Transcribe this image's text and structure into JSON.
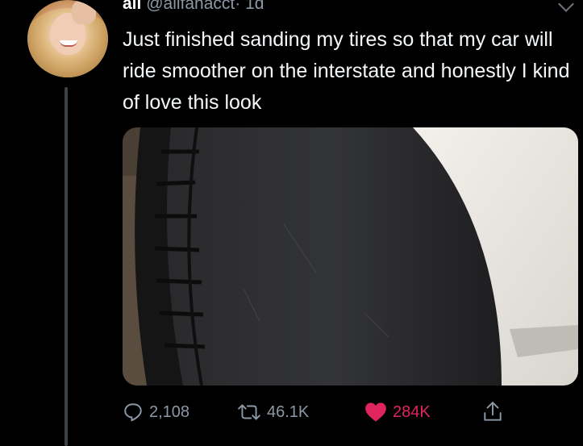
{
  "tweet": {
    "display_name": "ali",
    "handle": "@alifanacct",
    "separator": "·",
    "time": "1d",
    "text": "Just finished sanding my tires so that my car will ride smoother on the interstate and honestly I kind of love this look"
  },
  "actions": {
    "replies": "2,108",
    "retweets": "46.1K",
    "likes": "284K"
  },
  "colors": {
    "background": "#000000",
    "secondary_text": "#8b98a5",
    "like_red": "#e0245e"
  },
  "icons": [
    "avatar",
    "more-caret-icon",
    "reply-icon",
    "retweet-icon",
    "heart-icon",
    "share-icon"
  ]
}
